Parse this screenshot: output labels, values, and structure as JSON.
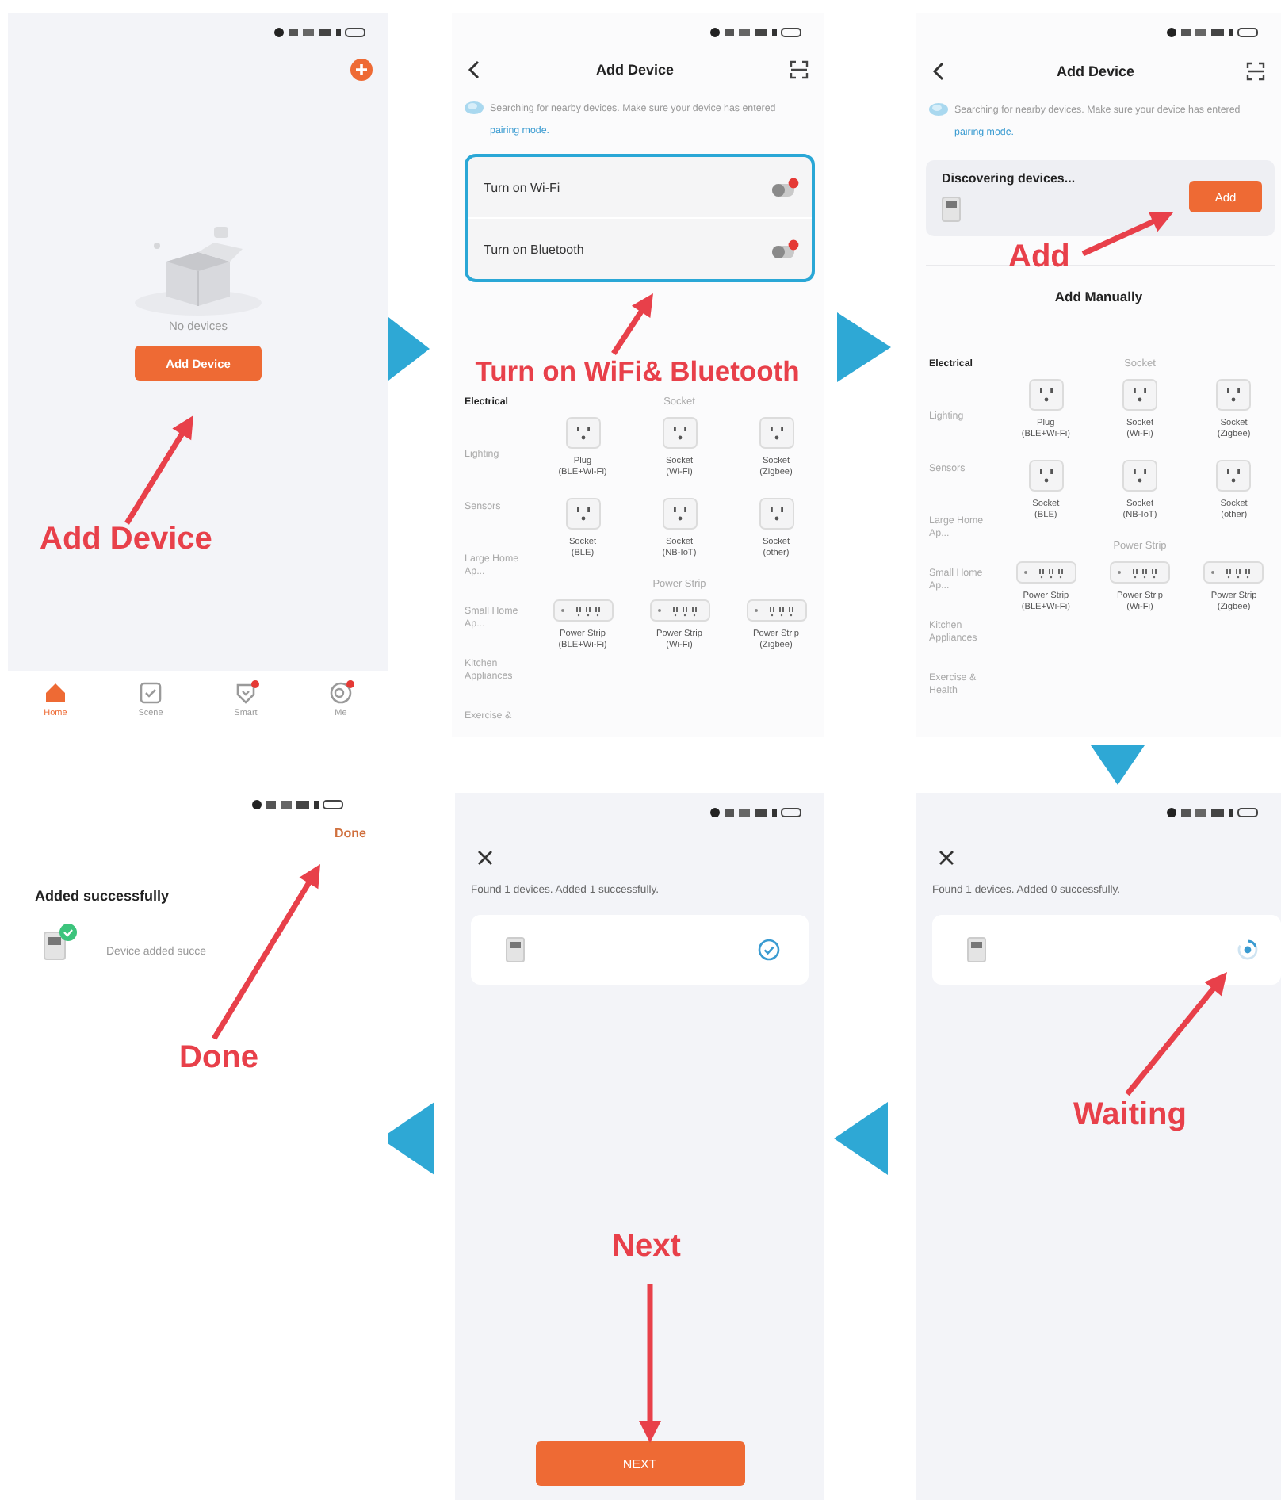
{
  "panels": [
    {
      "kind": "home",
      "empty_text": "No devices",
      "button": "Add Device",
      "tabs": [
        {
          "label": "Home",
          "selected": true,
          "badge": false
        },
        {
          "label": "Scene",
          "selected": false,
          "badge": false
        },
        {
          "label": "Smart",
          "selected": false,
          "badge": true
        },
        {
          "label": "Me",
          "selected": false,
          "badge": true
        }
      ],
      "callout": "Add Device"
    },
    {
      "kind": "search",
      "title": "Add Device",
      "notice": "Searching for nearby devices. Make sure your device has entered",
      "notice_link": "pairing mode.",
      "toggles": [
        {
          "label": "Turn on Wi-Fi",
          "on": false
        },
        {
          "label": "Turn on Bluetooth",
          "on": false
        }
      ],
      "categories": [
        {
          "label": "Electrical",
          "selected": true
        },
        {
          "label": "Lighting",
          "selected": false
        },
        {
          "label": "Sensors",
          "selected": false
        },
        {
          "label": "Large Home Ap...",
          "selected": false
        },
        {
          "label": "Small Home Ap...",
          "selected": false
        },
        {
          "label": "Kitchen Appliances",
          "selected": false
        },
        {
          "label": "Exercise &",
          "selected": false
        }
      ],
      "groups": [
        {
          "title": "Socket",
          "items": [
            {
              "kind": "socket",
              "name": "Plug",
              "variant": "(BLE+Wi-Fi)"
            },
            {
              "kind": "socket",
              "name": "Socket",
              "variant": "(Wi-Fi)"
            },
            {
              "kind": "socket",
              "name": "Socket",
              "variant": "(Zigbee)"
            },
            {
              "kind": "socket",
              "name": "Socket",
              "variant": "(BLE)"
            },
            {
              "kind": "socket",
              "name": "Socket",
              "variant": "(NB-IoT)"
            },
            {
              "kind": "socket",
              "name": "Socket",
              "variant": "(other)"
            }
          ]
        },
        {
          "title": "Power Strip",
          "items": [
            {
              "kind": "strip",
              "name": "Power Strip",
              "variant": "(BLE+Wi-Fi)"
            },
            {
              "kind": "strip",
              "name": "Power Strip",
              "variant": "(Wi-Fi)"
            },
            {
              "kind": "strip",
              "name": "Power Strip",
              "variant": "(Zigbee)"
            }
          ]
        }
      ],
      "callout": "Turn on WiFi& Bluetooth"
    },
    {
      "kind": "discover",
      "title": "Add Device",
      "notice": "Searching for nearby devices. Make sure your device has entered",
      "notice_link": "pairing mode.",
      "discovering": "Discovering devices...",
      "add_button": "Add",
      "section": "Add Manually",
      "categories": [
        {
          "label": "Electrical",
          "selected": true
        },
        {
          "label": "Lighting",
          "selected": false
        },
        {
          "label": "Sensors",
          "selected": false
        },
        {
          "label": "Large Home Ap...",
          "selected": false
        },
        {
          "label": "Small Home Ap...",
          "selected": false
        },
        {
          "label": "Kitchen Appliances",
          "selected": false
        },
        {
          "label": "Exercise & Health",
          "selected": false
        }
      ],
      "groups": [
        {
          "title": "Socket",
          "items": [
            {
              "kind": "socket",
              "name": "Plug",
              "variant": "(BLE+Wi-Fi)"
            },
            {
              "kind": "socket",
              "name": "Socket",
              "variant": "(Wi-Fi)"
            },
            {
              "kind": "socket",
              "name": "Socket",
              "variant": "(Zigbee)"
            },
            {
              "kind": "socket",
              "name": "Socket",
              "variant": "(BLE)"
            },
            {
              "kind": "socket",
              "name": "Socket",
              "variant": "(NB-IoT)"
            },
            {
              "kind": "socket",
              "name": "Socket",
              "variant": "(other)"
            }
          ]
        },
        {
          "title": "Power Strip",
          "items": [
            {
              "kind": "strip",
              "name": "Power Strip",
              "variant": "(BLE+Wi-Fi)"
            },
            {
              "kind": "strip",
              "name": "Power Strip",
              "variant": "(Wi-Fi)"
            },
            {
              "kind": "strip",
              "name": "Power Strip",
              "variant": "(Zigbee)"
            }
          ]
        }
      ],
      "callout": "Add"
    },
    {
      "kind": "done",
      "action": "Done",
      "heading": "Added successfully",
      "device_status": "Device added succe",
      "callout": "Done"
    },
    {
      "kind": "result",
      "message": "Found 1 devices. Added 1 successfully.",
      "devices": [
        {
          "added": true
        }
      ],
      "button": "NEXT",
      "callout": "Next"
    },
    {
      "kind": "result",
      "message": "Found 1 devices. Added 0 successfully.",
      "devices": [
        {
          "added": false
        }
      ],
      "callout": "Waiting"
    }
  ]
}
